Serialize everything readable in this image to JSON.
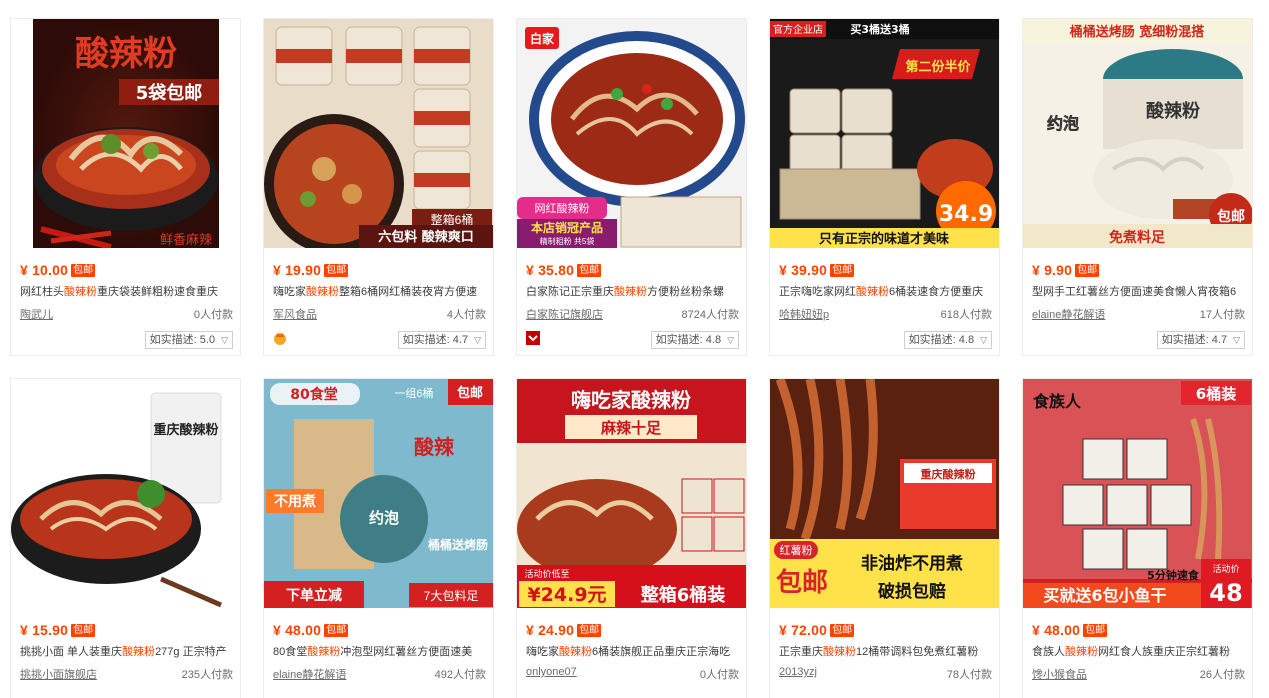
{
  "products": [
    {
      "price": "¥ 10.00",
      "free": "包邮",
      "title_pre": "网红柱头",
      "title_kw": "酸辣粉",
      "title_post": "重庆袋装鲜粗粉速食重庆",
      "shop": "陶武儿",
      "paid": "0人付款",
      "desc_label": "如实描述:",
      "desc_score": "5.0",
      "img_text": [
        "酸辣粉",
        "5袋包邮",
        "鲜香麻辣"
      ],
      "colors": {
        "bg": "#3a0e0a",
        "bowl": "#c1361c"
      }
    },
    {
      "price": "¥ 19.90",
      "free": "包邮",
      "title_pre": "嗨吃家",
      "title_kw": "酸辣粉",
      "title_post": "整箱6桶网红桶装夜宵方便速",
      "shop": "军风食品",
      "paid": "4人付款",
      "desc_label": "如实描述:",
      "desc_score": "4.7",
      "img_text": [
        "整箱6桶",
        "六包料 酸辣爽口"
      ],
      "colors": {
        "bg": "#e9ddc9",
        "bowl": "#b8431f"
      }
    },
    {
      "price": "¥ 35.80",
      "free": "包邮",
      "title_pre": "白家陈记正宗重庆",
      "title_kw": "酸辣粉",
      "title_post": "方便粉丝粉条螺",
      "shop": "白家陈记旗舰店",
      "paid": "8724人付款",
      "desc_label": "如实描述:",
      "desc_score": "4.8",
      "img_text": [
        "白家",
        "网红酸辣粉",
        "本店销冠产品",
        "精制粗粉 共5袋"
      ],
      "colors": {
        "bg": "#f3f3f3",
        "bowl": "#9c2a14"
      }
    },
    {
      "price": "¥ 39.90",
      "free": "包邮",
      "title_pre": "正宗嗨吃家网红",
      "title_kw": "酸辣粉",
      "title_post": "6桶装速食方便重庆",
      "shop": "哈韩妞妞p",
      "paid": "618人付款",
      "desc_label": "如实描述:",
      "desc_score": "4.8",
      "img_text": [
        "官方企业店",
        "买3桶送3桶",
        "第二份半价",
        "34.9",
        "只有正宗的味道才美味"
      ],
      "colors": {
        "bg": "#1a1a1a",
        "bowl": "#c23d1c"
      }
    },
    {
      "price": "¥ 9.90",
      "free": "包邮",
      "title_pre": "型网手工红薯丝方便面速美食懒人宵夜箱6",
      "title_kw": "",
      "title_post": "",
      "shop": "elaine静花解语",
      "paid": "17人付款",
      "desc_label": "如实描述:",
      "desc_score": "4.7",
      "img_text": [
        "桶桶送烤肠 宽细粉混搭",
        "约泡",
        "酸辣粉",
        "包邮",
        "免煮料足"
      ],
      "colors": {
        "bg": "#f6f1e6",
        "bowl": "#c32a18"
      }
    },
    {
      "price": "¥ 15.90",
      "free": "包邮",
      "title_pre": "挑挑小面 单人装重庆",
      "title_kw": "酸辣粉",
      "title_post": "277g 正宗特产",
      "shop": "挑挑小面旗舰店",
      "paid": "235人付款",
      "img_text": [
        "重庆酸辣粉"
      ],
      "colors": {
        "bg": "#ffffff",
        "bowl": "#b8341a"
      }
    },
    {
      "price": "¥ 48.00",
      "free": "包邮",
      "title_pre": "80食堂",
      "title_kw": "酸辣粉",
      "title_post": "冲泡型网红薯丝方便面速美",
      "shop": "elaine静花解语",
      "paid": "492人付款",
      "img_text": [
        "80食堂",
        "一组6桶",
        "包邮",
        "酸辣",
        "不用煮",
        "约泡",
        "桶桶送烤肠",
        "下单立减",
        "7大包料足"
      ],
      "colors": {
        "bg": "#6fb0c8",
        "bowl": "#d9b98a"
      }
    },
    {
      "price": "¥ 24.90",
      "free": "包邮",
      "title_pre": "嗨吃家",
      "title_kw": "酸辣粉",
      "title_post": "6桶装旗舰正品重庆正宗海吃",
      "shop": "onlyone07",
      "paid": "0人付款",
      "img_text": [
        "嗨吃家酸辣粉",
        "麻辣十足",
        "活动价低至",
        "¥24.9元",
        "整箱6桶装"
      ],
      "colors": {
        "bg": "#c7151d",
        "bowl": "#a83a1d"
      }
    },
    {
      "price": "¥ 72.00",
      "free": "包邮",
      "title_pre": "正宗重庆",
      "title_kw": "酸辣粉",
      "title_post": "12桶带调料包免煮红薯粉",
      "shop": "2013yzj",
      "paid": "78人付款",
      "img_text": [
        "重庆酸辣粉",
        "红薯粉",
        "包邮",
        "非油炸不用煮",
        "破损包赔"
      ],
      "colors": {
        "bg": "#5a2110",
        "bowl": "#b3461e"
      }
    },
    {
      "price": "¥ 48.00",
      "free": "包邮",
      "title_pre": "食族人",
      "title_kw": "酸辣粉",
      "title_post": "网红食人族重庆正宗红薯粉",
      "shop": "馋小猴食品",
      "paid": "26人付款",
      "img_text": [
        "食族人",
        "6桶装",
        "5分钟速食",
        "买就送6包小鱼干",
        "活动价",
        "48"
      ],
      "colors": {
        "bg": "#d11f26",
        "bowl": "#c04a22"
      }
    }
  ]
}
